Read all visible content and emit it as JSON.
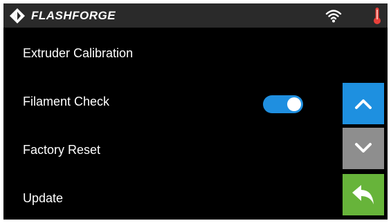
{
  "header": {
    "brand": "FLASHFORGE",
    "logo_icon": "flashforge-logo-icon",
    "status_icons": [
      "wifi-icon",
      "thermometer-icon"
    ]
  },
  "menu": {
    "items": [
      {
        "label": "Extruder Calibration"
      },
      {
        "label": "Filament Check",
        "toggle": true,
        "toggle_on": true
      },
      {
        "label": "Factory Reset"
      },
      {
        "label": "Update"
      }
    ]
  },
  "nav": {
    "up_icon": "chevron-up-icon",
    "down_icon": "chevron-down-icon",
    "back_icon": "back-arrow-icon"
  },
  "colors": {
    "accent_blue": "#1e90e0",
    "disabled_gray": "#8e8e8e",
    "back_green": "#67b43a",
    "thermometer_red": "#e8403a"
  }
}
